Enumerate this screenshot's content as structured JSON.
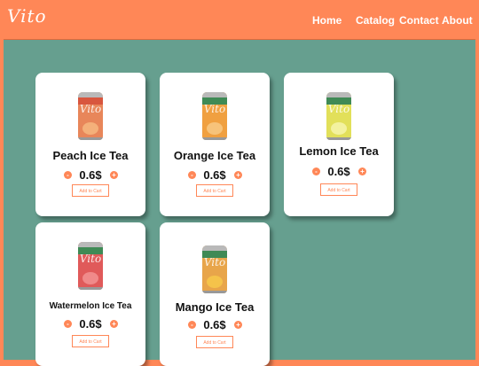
{
  "header": {
    "logo": "Vito",
    "nav": [
      "Home",
      "Catalog",
      "Contact",
      "About"
    ]
  },
  "colors": {
    "accent": "#ff8757",
    "background": "#669f8f",
    "card": "#ffffff"
  },
  "products": [
    {
      "name": "Peach Ice Tea",
      "price": "0.6$",
      "minus": "-",
      "plus": "+",
      "add_label": "Add to Cart",
      "can_label": "Vito"
    },
    {
      "name": "Orange Ice Tea",
      "price": "0.6$",
      "minus": "-",
      "plus": "+",
      "add_label": "Add to Cart",
      "can_label": "Vito"
    },
    {
      "name": "Lemon Ice Tea",
      "price": "0.6$",
      "minus": "-",
      "plus": "+",
      "add_label": "Add to Cart",
      "can_label": "Vito"
    },
    {
      "name": "Watermelon Ice Tea",
      "price": "0.6$",
      "minus": "-",
      "plus": "+",
      "add_label": "Add to Cart",
      "can_label": "Vito"
    },
    {
      "name": "Mango Ice Tea",
      "price": "0.6$",
      "minus": "-",
      "plus": "+",
      "add_label": "Add to Cart",
      "can_label": "Vito"
    }
  ]
}
